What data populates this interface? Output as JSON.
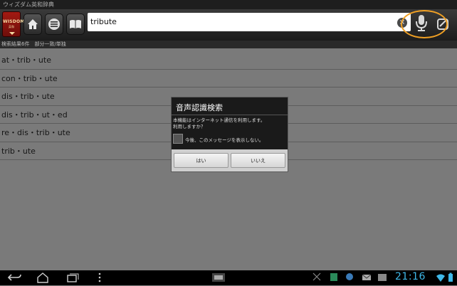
{
  "window": {
    "title": "ウィズダム英和辞典"
  },
  "toolbar": {
    "logo_line1": "WISDOM",
    "logo_line2": "英和",
    "search_value": "tribute"
  },
  "results": {
    "header": "検索結果6件　部分一致/単独",
    "items": [
      "at・trib・ute",
      "con・trib・ute",
      "dis・trib・ute",
      "dis・trib・ut・ed",
      "re・dis・trib・ute",
      "trib・ute"
    ]
  },
  "dialog": {
    "title": "音声認識検索",
    "message_line1": "本機能はインターネット通信を利用します。",
    "message_line2": "利用しますか？",
    "checkbox_label": "今後、このメッセージを表示しない。",
    "yes_label": "はい",
    "no_label": "いいえ"
  },
  "statusbar": {
    "clock": "21:16"
  },
  "colors": {
    "accent_highlight": "#f0a024",
    "clock": "#3fb8e8"
  }
}
